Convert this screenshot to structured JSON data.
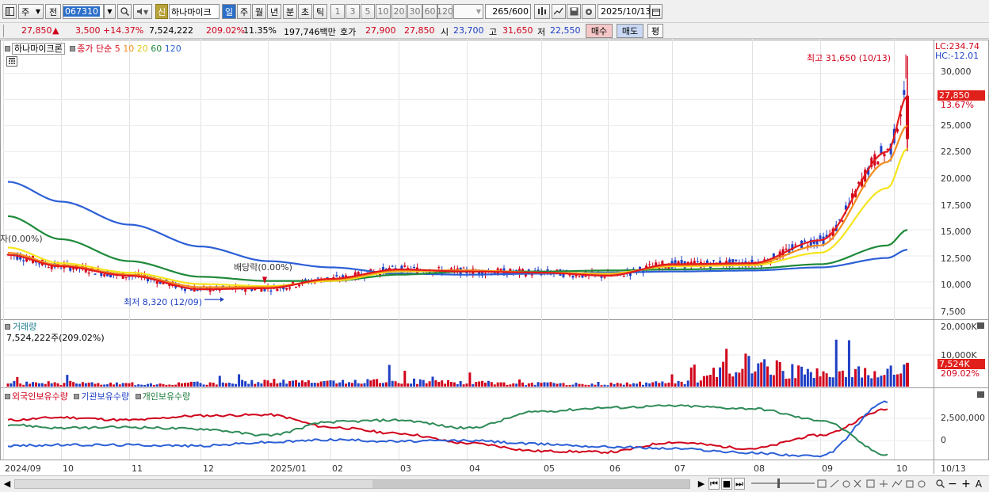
{
  "toolbar": {
    "type_option": "주",
    "prev_label": "전",
    "code_value": "067310",
    "company_name": "하나마이크",
    "new_badge": "신",
    "periods": [
      "일",
      "주",
      "월",
      "년",
      "분",
      "초",
      "틱"
    ],
    "interval_numbers": [
      "1",
      "3",
      "5",
      "10",
      "20",
      "30",
      "60",
      "120"
    ],
    "count_value": "265",
    "count_total": "/600",
    "date_value": "2025/10/13"
  },
  "quote": {
    "price": "27,850",
    "arrow": "▲",
    "change": "3,500",
    "change_pct": "+14.37%",
    "volume": "7,524,222",
    "volume_ratio": "209.02%",
    "turnover": "11.35%",
    "amount": "197,746백만",
    "hoga_label": "호가",
    "bid": "27,900",
    "ask": "27,850",
    "open_label": "시",
    "open": "23,700",
    "high_label": "고",
    "high": "31,650",
    "low_label": "저",
    "low": "22,550",
    "buy_button": "매수",
    "sell_button": "매도",
    "eval_button": "평"
  },
  "price_panel": {
    "stock_name": "하나마이크론",
    "legend_label": "종가 단순",
    "ma_labels": [
      "5",
      "10",
      "20",
      "60",
      "120"
    ],
    "lc": "LC:234.74",
    "hc": "HC:-12.01",
    "high_annotation": "최고 31,650 (10/13)",
    "low_annotation": "최저 8,320 (12/09)",
    "dividend_annotation": "배당락(0.00%)",
    "left_annotation": "자(0.00%)",
    "current_price_tag": "27,850",
    "current_pct_tag": "13.67%"
  },
  "volume_panel": {
    "title": "거래량",
    "value": "7,524,222주(209.02%)",
    "current_tag": "7,524K",
    "current_pct": "209.02%"
  },
  "holdings_panel": {
    "legend": [
      "외국인보유수량",
      "기관보유수량",
      "개인보유수량"
    ]
  },
  "nav": {
    "first_button": "⏮",
    "stop_button": "■",
    "last_button": "⏭",
    "zoom_out_label": "−",
    "zoom_in_label": "+",
    "font_label": "A"
  },
  "colors": {
    "candle_up": "#d0021b",
    "candle_down": "#1f3fc4",
    "ma5": "#e31a1c",
    "ma10": "#f28c1e",
    "ma20": "#f5e51b",
    "ma60": "#1f8a3a",
    "ma120": "#2c5fd6",
    "foreign": "#d0021b",
    "institution": "#2c5fd6",
    "individual": "#2e8b57"
  },
  "chart_data": [
    {
      "type": "line",
      "title": "하나마이크론",
      "ylim": [
        6500,
        33000
      ],
      "y_ticks": [
        "30,000",
        "27,500",
        "25,000",
        "22,500",
        "20,000",
        "17,500",
        "15,000",
        "12,500",
        "10,000",
        "7,500"
      ],
      "x_ticks": [
        "2024/09",
        "10",
        "11",
        "12",
        "2025/01",
        "02",
        "03",
        "04",
        "05",
        "06",
        "07",
        "08",
        "09",
        "10",
        "10/13"
      ],
      "x": [
        "2024/09",
        "10",
        "11",
        "12",
        "2025/01",
        "02",
        "03",
        "04",
        "05",
        "06",
        "07",
        "08",
        "09",
        "10",
        "10/13"
      ],
      "series": [
        {
          "name": "5",
          "values": [
            12600,
            11500,
            10600,
            9300,
            9400,
            10300,
            11200,
            11000,
            10900,
            10600,
            11700,
            11800,
            14000,
            22500,
            27850
          ]
        },
        {
          "name": "10",
          "values": [
            12800,
            11600,
            10700,
            9500,
            9500,
            10200,
            11100,
            11100,
            10900,
            10700,
            11600,
            11700,
            13500,
            21500,
            25000
          ]
        },
        {
          "name": "20",
          "values": [
            13300,
            11800,
            10900,
            9800,
            9600,
            10100,
            11000,
            11100,
            10900,
            10800,
            11500,
            11600,
            12800,
            19000,
            22800
          ]
        },
        {
          "name": "60",
          "values": [
            16300,
            14100,
            12000,
            10500,
            10100,
            10100,
            10700,
            11000,
            11000,
            11100,
            11200,
            11300,
            11700,
            13500,
            15000
          ]
        },
        {
          "name": "120",
          "values": [
            19600,
            17700,
            15500,
            13400,
            12000,
            11400,
            10800,
            10700,
            10800,
            10900,
            11000,
            11100,
            11400,
            12300,
            13100
          ]
        }
      ]
    },
    {
      "type": "bar",
      "title": "거래량",
      "ylim": [
        0,
        20000
      ],
      "y_ticks": [
        "20,000K",
        "10,000K"
      ],
      "categories": [
        "2024/09",
        "10",
        "11",
        "12",
        "2025/01",
        "02",
        "03",
        "04",
        "05",
        "06",
        "07",
        "08",
        "09",
        "10",
        "10/13"
      ],
      "values": [
        1600,
        1300,
        1200,
        1400,
        2300,
        1800,
        2500,
        1700,
        1300,
        1100,
        1600,
        9000,
        5000,
        6000,
        7524
      ]
    },
    {
      "type": "line",
      "title": "보유수량",
      "y_ticks": [
        "2,500,000",
        "0"
      ],
      "categories": [
        "2024/09",
        "10",
        "11",
        "12",
        "2025/01",
        "02",
        "03",
        "04",
        "05",
        "06",
        "07",
        "08",
        "09",
        "10"
      ],
      "series": [
        {
          "name": "외국인보유수량",
          "values": [
            2300000,
            2600000,
            2300000,
            2800000,
            2900000,
            1500000,
            800000,
            -300000,
            -1200000,
            -1300000,
            -200000,
            -900000,
            600000,
            3500000
          ]
        },
        {
          "name": "기관보유수량",
          "values": [
            -600000,
            -500000,
            -500000,
            -600000,
            -200000,
            100000,
            -100000,
            0,
            -400000,
            -700000,
            -900000,
            -1400000,
            -1800000,
            4400000
          ]
        },
        {
          "name": "개인보유수량",
          "values": [
            1800000,
            1400000,
            1500000,
            1300000,
            600000,
            2100000,
            2300000,
            1400000,
            3300000,
            3700000,
            3900000,
            3600000,
            2300000,
            -1600000
          ]
        }
      ]
    }
  ]
}
